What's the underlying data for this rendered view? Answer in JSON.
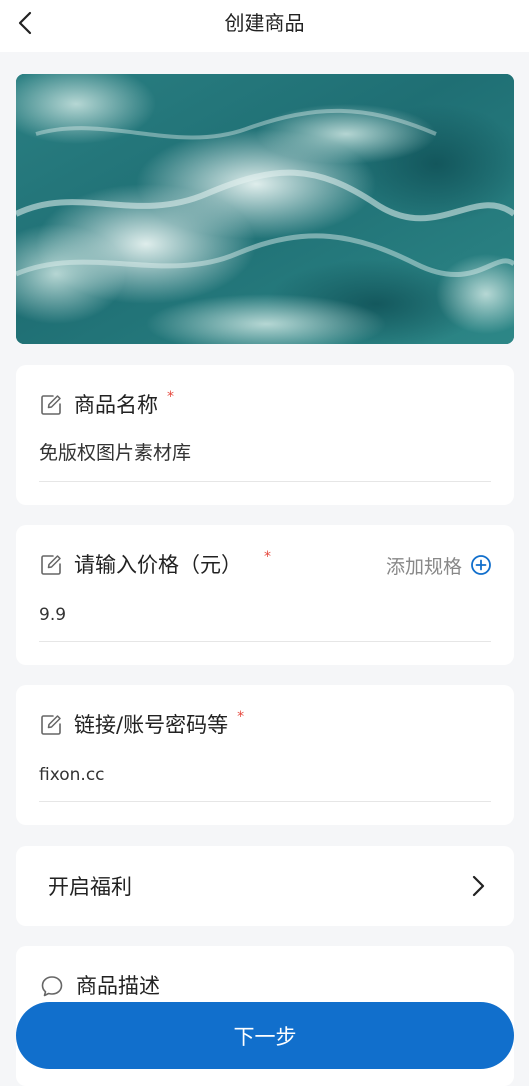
{
  "header": {
    "title": "创建商品",
    "back_icon": "chevron-left-icon"
  },
  "hero": {
    "image": "ocean-waves-photo"
  },
  "fields": {
    "name": {
      "label": "商品名称",
      "required_mark": "*",
      "value": "免版权图片素材库",
      "icon": "edit-icon"
    },
    "price": {
      "label": "请输入价格（元）",
      "required_mark": "*",
      "value": "9.9",
      "icon": "edit-icon",
      "add_spec_label": "添加规格",
      "add_spec_icon": "plus-circle-icon"
    },
    "link": {
      "label": "链接/账号密码等",
      "required_mark": "*",
      "value": "fixon.cc",
      "icon": "edit-icon"
    }
  },
  "welfare": {
    "label": "开启福利",
    "icon": "chevron-right-icon"
  },
  "description": {
    "label": "商品描述",
    "icon": "chat-bubble-icon"
  },
  "footer": {
    "next_label": "下一步"
  },
  "colors": {
    "primary": "#116fcc",
    "required": "#e5483d",
    "background": "#f5f6f8",
    "card": "#ffffff"
  }
}
